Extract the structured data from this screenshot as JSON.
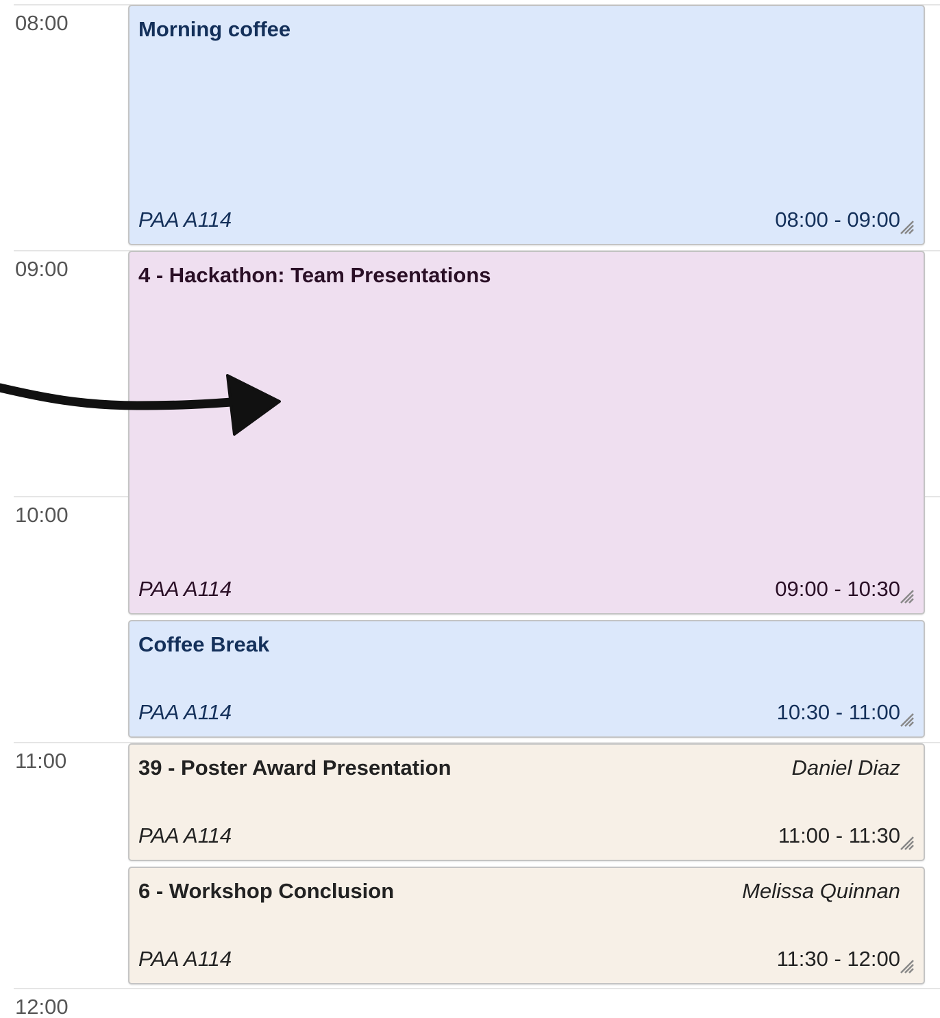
{
  "time_axis": {
    "hours": [
      "08:00",
      "09:00",
      "10:00",
      "11:00",
      "12:00"
    ]
  },
  "colors": {
    "blue_event_bg": "#dce8fb",
    "blue_event_text": "#14305a",
    "purple_event_bg": "#efdff0",
    "purple_event_text": "#2a0f26",
    "beige_event_bg": "#f7f0e7",
    "beige_event_text": "#222222"
  },
  "events": [
    {
      "title": "Morning coffee",
      "room": "PAA A114",
      "time": "08:00 - 09:00",
      "speaker": "",
      "style": "blue"
    },
    {
      "title": "4 - Hackathon: Team Presentations",
      "room": "PAA A114",
      "time": "09:00 - 10:30",
      "speaker": "",
      "style": "purple"
    },
    {
      "title": "Coffee Break",
      "room": "PAA A114",
      "time": "10:30 - 11:00",
      "speaker": "",
      "style": "blue"
    },
    {
      "title": "39 - Poster Award Presentation",
      "room": "PAA A114",
      "time": "11:00 - 11:30",
      "speaker": "Daniel Diaz",
      "style": "beige"
    },
    {
      "title": "6 - Workshop Conclusion",
      "room": "PAA A114",
      "time": "11:30 - 12:00",
      "speaker": "Melissa Quinnan",
      "style": "beige"
    }
  ]
}
